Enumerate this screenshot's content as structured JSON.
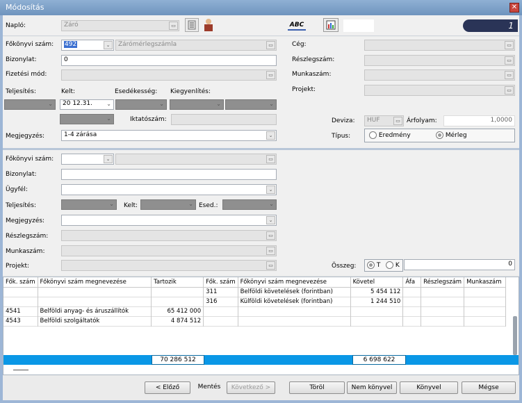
{
  "window": {
    "title": "Módosítás",
    "close_glyph": "✕"
  },
  "top": {
    "naplo_label": "Napló:",
    "naplo_value": "Záró",
    "abc_label": "ABC",
    "page_number": "1"
  },
  "header": {
    "fokonyvi_label": "Főkönyvi szám:",
    "fokonyvi_value": "492",
    "fokonyvi_name": "Zárómérlegszámla",
    "bizonylat_label": "Bizonylat:",
    "bizonylat_value": "0",
    "fizetesi_label": "Fizetési mód:",
    "teljesites_label": "Teljesítés:",
    "kelt_label": "Kelt:",
    "esedekesseg_label": "Esedékesség:",
    "kiegyenlites_label": "Kiegyenlítés:",
    "kelt_value": "20   12.31.",
    "iktato_label": "Iktatószám:",
    "megjegyzes_label": "Megjegyzés:",
    "megjegyzes_value": "1-4 zárása",
    "ceg_label": "Cég:",
    "reszleg_label": "Részlegszám:",
    "munkaszam_label": "Munkaszám:",
    "projekt_label": "Projekt:",
    "deviza_label": "Deviza:",
    "deviza_value": "HUF",
    "arfolyam_label": "Árfolyam:",
    "arfolyam_value": "1,0000",
    "tipus_label": "Típus:",
    "tipus_eredmeny": "Eredmény",
    "tipus_merleg": "Mérleg"
  },
  "item": {
    "fokonyvi_label": "Főkönyvi szám:",
    "bizonylat_label": "Bizonylat:",
    "ugyfel_label": "Ügyfél:",
    "teljesites_label": "Teljesítés:",
    "kelt_label": "Kelt:",
    "esed_label": "Esed.:",
    "megjegyzes_label": "Megjegyzés:",
    "reszleg_label": "Részlegszám:",
    "munkaszam_label": "Munkaszám:",
    "projekt_label": "Projekt:",
    "osszeg_label": "Összeg:",
    "osszeg_t": "T",
    "osszeg_k": "K",
    "osszeg_value": "0"
  },
  "table": {
    "headers": [
      "Fők. szám",
      "Főkönyvi szám megnevezése",
      "Tartozik",
      "Fők. szám",
      "Főkönyvi szám megnevezése",
      "Követel",
      "Áfa",
      "Részlegszám",
      "Munkaszám"
    ],
    "rows": [
      [
        "",
        "",
        "",
        "311",
        "Belföldi követelések (forintban)",
        "5 454 112",
        "",
        "",
        ""
      ],
      [
        "",
        "",
        "",
        "316",
        "Külföldi követelések (forintban)",
        "1 244 510",
        "",
        "",
        ""
      ],
      [
        "4541",
        "Belföldi anyag- és áruszállítók",
        "65 412 000",
        "",
        "",
        "",
        "",
        "",
        ""
      ],
      [
        "4543",
        "Belföldi szolgáltatók",
        "4 874 512",
        "",
        "",
        "",
        "",
        "",
        ""
      ]
    ],
    "total_tartozik": "70 286 512",
    "total_kovetel": "6 698 622"
  },
  "buttons": {
    "elozo": "< Előző",
    "mentes": "Mentés",
    "kovetkezo": "Következő >",
    "torol": "Töröl",
    "nem_konyvel": "Nem könyvel",
    "konyvel": "Könyvel",
    "megse": "Mégse"
  },
  "colors": {
    "total_bar": "#0a97e6",
    "titlebar": "#7a9cc6",
    "page_badge": "#2a3457"
  }
}
